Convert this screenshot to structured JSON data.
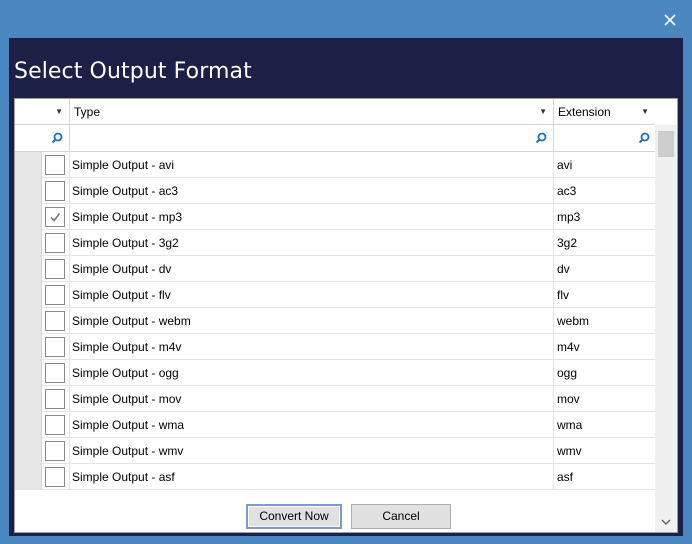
{
  "window": {
    "title": "Select Output Format",
    "close_icon": "close-icon"
  },
  "grid": {
    "columns": [
      {
        "key": "select",
        "label": ""
      },
      {
        "key": "type",
        "label": "Type"
      },
      {
        "key": "extension",
        "label": "Extension"
      }
    ],
    "filter_icon": "magnifier-icon",
    "rows": [
      {
        "checked": false,
        "type": "Simple Output - avi",
        "extension": "avi"
      },
      {
        "checked": false,
        "type": "Simple Output - ac3",
        "extension": "ac3"
      },
      {
        "checked": true,
        "type": "Simple Output - mp3",
        "extension": "mp3"
      },
      {
        "checked": false,
        "type": "Simple Output - 3g2",
        "extension": "3g2"
      },
      {
        "checked": false,
        "type": "Simple Output - dv",
        "extension": "dv"
      },
      {
        "checked": false,
        "type": "Simple Output - flv",
        "extension": "flv"
      },
      {
        "checked": false,
        "type": "Simple Output - webm",
        "extension": "webm"
      },
      {
        "checked": false,
        "type": "Simple Output - m4v",
        "extension": "m4v"
      },
      {
        "checked": false,
        "type": "Simple Output - ogg",
        "extension": "ogg"
      },
      {
        "checked": false,
        "type": "Simple Output - mov",
        "extension": "mov"
      },
      {
        "checked": false,
        "type": "Simple Output - wma",
        "extension": "wma"
      },
      {
        "checked": false,
        "type": "Simple Output - wmv",
        "extension": "wmv"
      },
      {
        "checked": false,
        "type": "Simple Output - asf",
        "extension": "asf"
      }
    ]
  },
  "buttons": {
    "convert": "Convert Now",
    "cancel": "Cancel"
  },
  "colors": {
    "title_bar": "#4a86c0",
    "client_bg": "#1c1f46",
    "filter_icon": "#1a6fc4"
  }
}
